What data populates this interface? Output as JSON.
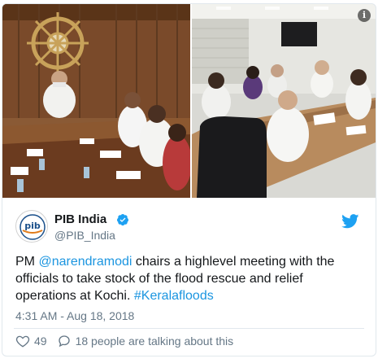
{
  "tweet": {
    "author": {
      "name": "PIB India",
      "handle": "@PIB_India",
      "avatar_label": "pib"
    },
    "text": {
      "prefix": "PM ",
      "mention": "@narendramodi",
      "body": " chairs a  highlevel meeting with the officials to take stock of the flood rescue and relief operations at Kochi.  ",
      "hashtag": "#Keralafloods"
    },
    "timestamp": "4:31 AM - Aug 18, 2018",
    "likes_count": "49",
    "conversation_label": "18 people are talking about this",
    "media_info_symbol": "i"
  },
  "colors": {
    "link": "#1b95e0",
    "verified": "#1da1f2",
    "twitter_brand": "#1da1f2",
    "muted_text": "#657786",
    "border": "#e1e8ed"
  },
  "icons": {
    "verified": "verified-badge-icon",
    "brand": "twitter-bird-icon",
    "like": "heart-icon",
    "reply": "speech-bubble-icon",
    "info": "info-icon"
  }
}
